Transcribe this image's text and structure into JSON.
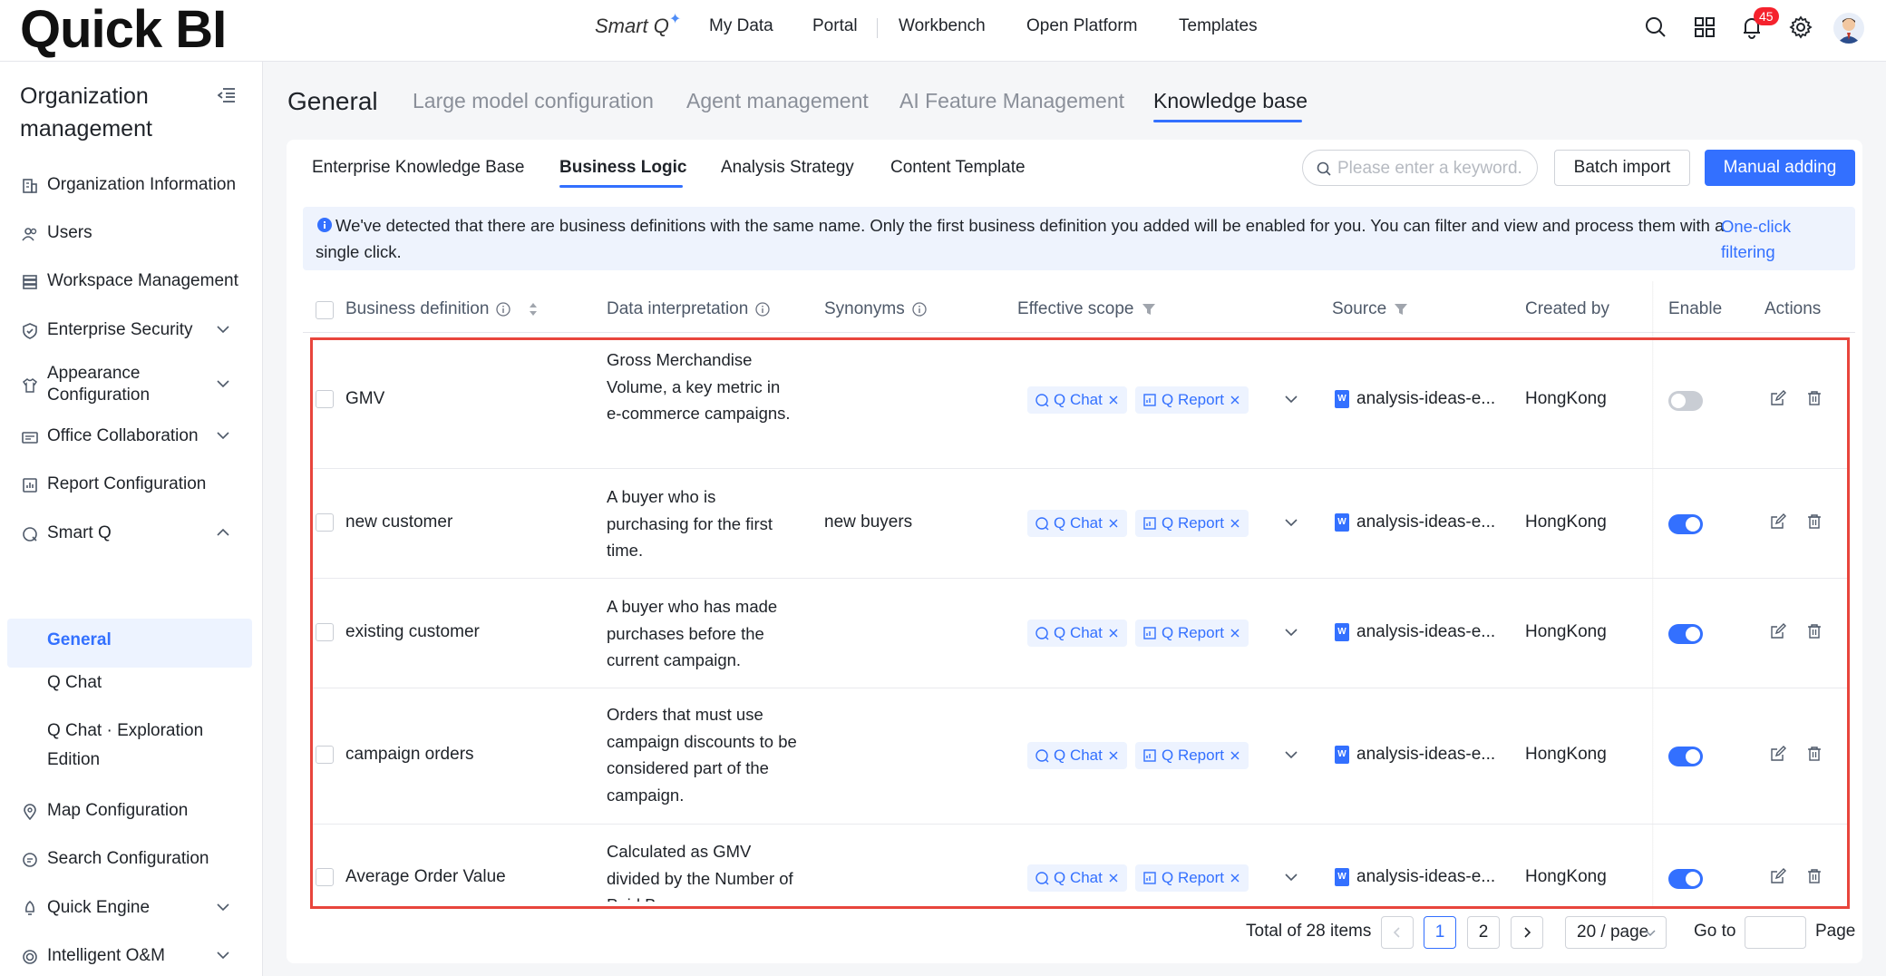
{
  "app": {
    "logo": "Quick BI"
  },
  "topnav": {
    "smartq_label": "Smart Q",
    "items": [
      "My Data",
      "Portal",
      "Workbench",
      "Open Platform",
      "Templates"
    ],
    "notification_count": "45"
  },
  "sidebar": {
    "title": "Organization management",
    "items": [
      {
        "label": "Organization Information",
        "icon": "building-icon"
      },
      {
        "label": "Users",
        "icon": "users-icon"
      },
      {
        "label": "Workspace Management",
        "icon": "workspace-icon"
      },
      {
        "label": "Enterprise Security",
        "icon": "shield-icon"
      },
      {
        "label": "Appearance Configuration",
        "icon": "shirt-icon"
      },
      {
        "label": "Office Collaboration",
        "icon": "collab-icon"
      },
      {
        "label": "Report Configuration",
        "icon": "report-icon"
      },
      {
        "label": "Smart Q",
        "icon": "smartq-icon"
      },
      {
        "label": "Map Configuration",
        "icon": "map-icon"
      },
      {
        "label": "Search Configuration",
        "icon": "search-config-icon"
      },
      {
        "label": "Quick Engine",
        "icon": "rocket-icon"
      },
      {
        "label": "Intelligent O&M",
        "icon": "target-icon"
      }
    ],
    "smartq_sub": [
      "General",
      "Q Chat",
      "Q Chat · Exploration Edition"
    ]
  },
  "header_tabs": [
    "General",
    "Large model configuration",
    "Agent management",
    "AI Feature Management",
    "Knowledge base"
  ],
  "sub_tabs": [
    "Enterprise Knowledge Base",
    "Business Logic",
    "Analysis Strategy",
    "Content Template"
  ],
  "toolbar": {
    "search_placeholder": "Please enter a keyword.",
    "batch_import": "Batch import",
    "manual_adding": "Manual adding"
  },
  "alert": {
    "message": "We've detected that there are business definitions with the same name. Only the first business definition you added will be enabled for you. You can filter and view and process them with a single click.",
    "link": "One-click filtering"
  },
  "table": {
    "columns": [
      "Business definition",
      "Data interpretation",
      "Synonyms",
      "Effective scope",
      "Source",
      "Created by",
      "Enable",
      "Actions"
    ],
    "rows": [
      {
        "definition": "GMV",
        "interpretation": "Gross Merchandise Volume, a key metric in e-commerce campaigns.",
        "synonyms": "",
        "scope": [
          "Q Chat",
          "Q Report"
        ],
        "source": "analysis-ideas-e...",
        "created_by": "HongKong",
        "enabled": false
      },
      {
        "definition": "new customer",
        "interpretation": "A buyer who is purchasing for the first time.",
        "synonyms": "new buyers",
        "scope": [
          "Q Chat",
          "Q Report"
        ],
        "source": "analysis-ideas-e...",
        "created_by": "HongKong",
        "enabled": true
      },
      {
        "definition": "existing customer",
        "interpretation": "A buyer who has made purchases before the current campaign.",
        "synonyms": "",
        "scope": [
          "Q Chat",
          "Q Report"
        ],
        "source": "analysis-ideas-e...",
        "created_by": "HongKong",
        "enabled": true
      },
      {
        "definition": "campaign orders",
        "interpretation": "Orders that must use campaign discounts to be considered part of the campaign.",
        "synonyms": "",
        "scope": [
          "Q Chat",
          "Q Report"
        ],
        "source": "analysis-ideas-e...",
        "created_by": "HongKong",
        "enabled": true
      },
      {
        "definition": "Average Order Value",
        "interpretation": "Calculated as GMV divided by the Number of Paid B...",
        "synonyms": "",
        "scope": [
          "Q Chat",
          "Q Report"
        ],
        "source": "analysis-ideas-e...",
        "created_by": "HongKong",
        "enabled": true
      }
    ]
  },
  "pagination": {
    "total": "Total of 28 items",
    "pages": [
      "1",
      "2"
    ],
    "current": "1",
    "page_size": "20 / page",
    "goto": "Go to",
    "page_suffix": "Page"
  },
  "colors": {
    "accent": "#3370ff",
    "highlight_border": "#e8453c",
    "badge": "#f5222d"
  }
}
